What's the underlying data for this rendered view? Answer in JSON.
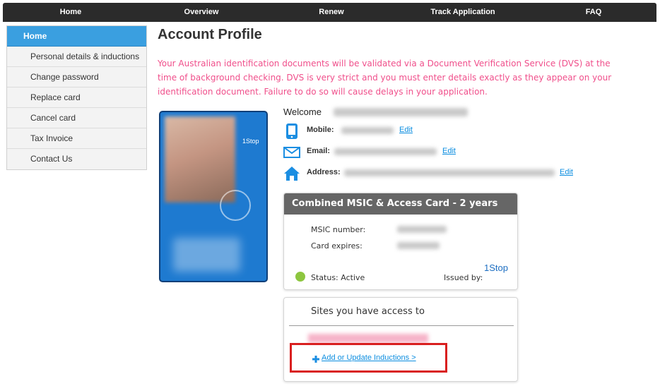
{
  "nav": {
    "items": [
      "Home",
      "Overview",
      "Renew",
      "Track Application",
      "FAQ"
    ]
  },
  "sidebar": {
    "items": [
      {
        "label": "Home",
        "active": true
      },
      {
        "label": "Personal details & inductions"
      },
      {
        "label": "Change password"
      },
      {
        "label": "Replace card"
      },
      {
        "label": "Cancel card"
      },
      {
        "label": "Tax Invoice"
      },
      {
        "label": "Contact Us"
      }
    ]
  },
  "main": {
    "title": "Account Profile",
    "notice": "Your Australian identification documents will be validated via a Document Verification Service (DVS) at the time of background checking. DVS is very strict and you must enter details exactly as they appear on your identification document. Failure to do so will cause delays in your application."
  },
  "id_card": {
    "brand": "1Stop"
  },
  "profile": {
    "welcome_label": "Welcome",
    "mobile_label": "Mobile:",
    "email_label": "Email:",
    "address_label": "Address:",
    "edit_label": "Edit"
  },
  "msic": {
    "header": "Combined MSIC & Access Card - 2 years",
    "number_label": "MSIC number:",
    "expires_label": "Card expires:",
    "status": "Status: Active",
    "status_color": "#8dc63f",
    "issued_by_label": "Issued by:",
    "issuer": "1Stop"
  },
  "sites": {
    "title": "Sites you have access to",
    "add_link": "Add or Update Inductions >"
  },
  "colors": {
    "accent": "#3a9fe0",
    "notice": "#f04f8b",
    "link": "#0d8ee0",
    "highlight": "#d91f1f"
  }
}
